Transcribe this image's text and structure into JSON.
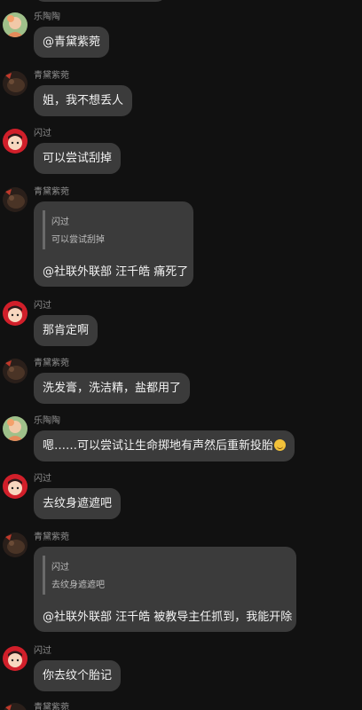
{
  "users": {
    "lt": "乐陶陶",
    "qd": "青黛紫菀",
    "sg": "闪过"
  },
  "messages": [
    {
      "sender": "乐陶陶",
      "text": "@青黛紫菀"
    },
    {
      "sender": "青黛紫菀",
      "text": "姐，我不想丢人"
    },
    {
      "sender": "闪过",
      "text": "可以尝试刮掉"
    },
    {
      "sender": "青黛紫菀",
      "quote_name": "闪过",
      "quote_text": "可以尝试刮掉",
      "text": "@社联外联部  汪千皓  痛死了"
    },
    {
      "sender": "闪过",
      "text": "那肯定啊"
    },
    {
      "sender": "青黛紫菀",
      "text": "洗发膏，洗洁精，盐都用了"
    },
    {
      "sender": "乐陶陶",
      "text": "嗯……可以尝试让生命掷地有声然后重新投胎",
      "emoji": "grin-emoji"
    },
    {
      "sender": "闪过",
      "text": "去纹身遮遮吧"
    },
    {
      "sender": "青黛紫菀",
      "quote_name": "闪过",
      "quote_text": "去纹身遮遮吧",
      "text": "@社联外联部  汪千皓  被教导主任抓到，我能开除"
    },
    {
      "sender": "闪过",
      "text": "你去纹个胎记"
    },
    {
      "sender": "青黛紫菀"
    }
  ],
  "colors": {
    "background": "#111111",
    "bubble": "#3b3b3b",
    "sender": "#8e8e8e",
    "text": "#f2f2f2"
  }
}
